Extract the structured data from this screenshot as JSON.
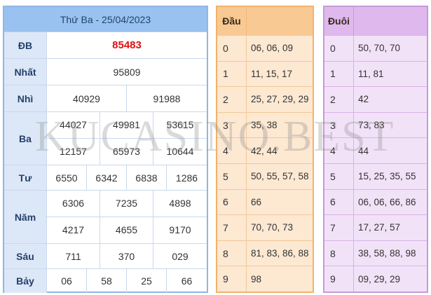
{
  "results": {
    "title": "Thứ Ba - 25/04/2023",
    "rows": [
      {
        "label": "ĐB",
        "values": [
          "85483"
        ]
      },
      {
        "label": "Nhất",
        "values": [
          "95809"
        ]
      },
      {
        "label": "Nhì",
        "values": [
          "40929",
          "91988"
        ]
      },
      {
        "label": "Ba",
        "values": [
          "44027",
          "49981",
          "53615",
          "12157",
          "65973",
          "10644"
        ]
      },
      {
        "label": "Tư",
        "values": [
          "6550",
          "6342",
          "6838",
          "1286"
        ]
      },
      {
        "label": "Năm",
        "values": [
          "6306",
          "7235",
          "4898",
          "4217",
          "4655",
          "9170"
        ]
      },
      {
        "label": "Sáu",
        "values": [
          "711",
          "370",
          "029"
        ]
      },
      {
        "label": "Bảy",
        "values": [
          "06",
          "58",
          "25",
          "66"
        ]
      }
    ]
  },
  "dau": {
    "title": "Đầu",
    "rows": [
      {
        "key": "0",
        "value": "06, 06, 09"
      },
      {
        "key": "1",
        "value": "11, 15, 17"
      },
      {
        "key": "2",
        "value": "25, 27, 29, 29"
      },
      {
        "key": "3",
        "value": "35, 38"
      },
      {
        "key": "4",
        "value": "42, 44"
      },
      {
        "key": "5",
        "value": "50, 55, 57, 58"
      },
      {
        "key": "6",
        "value": "66"
      },
      {
        "key": "7",
        "value": "70, 70, 73"
      },
      {
        "key": "8",
        "value": "81, 83, 86, 88"
      },
      {
        "key": "9",
        "value": "98"
      }
    ]
  },
  "duoi": {
    "title": "Đuôi",
    "rows": [
      {
        "key": "0",
        "value": "50, 70, 70"
      },
      {
        "key": "1",
        "value": "11, 81"
      },
      {
        "key": "2",
        "value": "42"
      },
      {
        "key": "3",
        "value": "73, 83"
      },
      {
        "key": "4",
        "value": "44"
      },
      {
        "key": "5",
        "value": "15, 25, 35, 55"
      },
      {
        "key": "6",
        "value": "06, 06, 66, 86"
      },
      {
        "key": "7",
        "value": "17, 27, 57"
      },
      {
        "key": "8",
        "value": "38, 58, 88, 98"
      },
      {
        "key": "9",
        "value": "09, 29, 29"
      }
    ]
  },
  "watermark": "KUCASINO.BEST",
  "colors": {
    "special_prize": "#e01010",
    "results_header": "#99c2f0",
    "dau_header": "#f9c993",
    "duoi_header": "#dfb9ee"
  }
}
